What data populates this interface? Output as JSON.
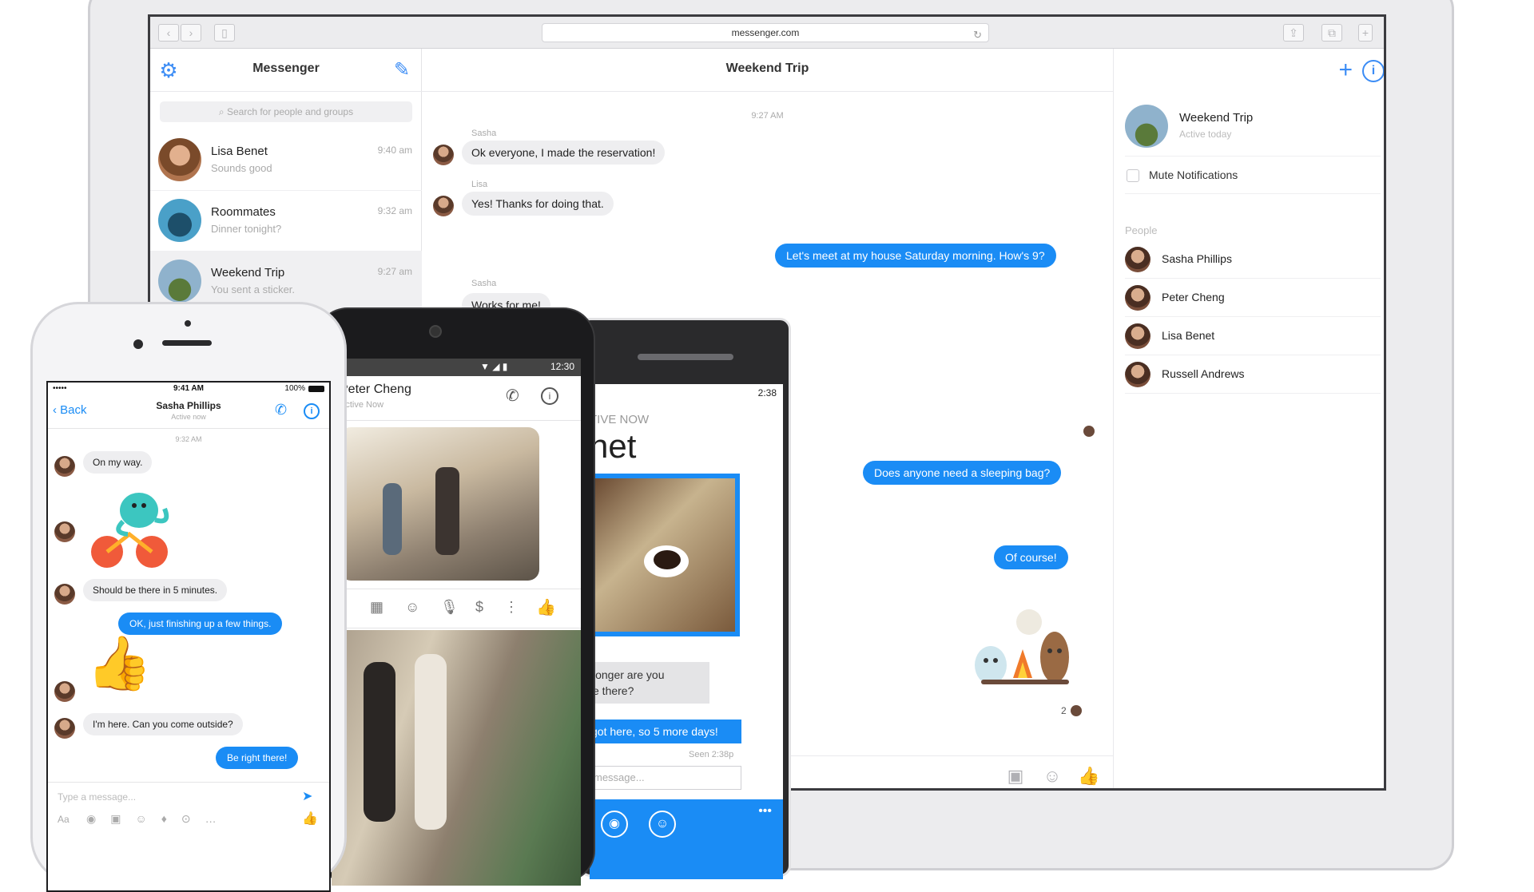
{
  "browser": {
    "url": "messenger.com"
  },
  "messenger_web": {
    "app_title": "Messenger",
    "search_placeholder": "Search for people and groups",
    "conversations": [
      {
        "name": "Lisa Benet",
        "preview": "Sounds good",
        "time": "9:40 am"
      },
      {
        "name": "Roommates",
        "preview": "Dinner tonight?",
        "time": "9:32 am"
      },
      {
        "name": "Weekend Trip",
        "preview": "You sent a sticker.",
        "time": "9:27 am"
      }
    ],
    "chat": {
      "title": "Weekend Trip",
      "timestamp": "9:27 AM",
      "messages": [
        {
          "sender": "Sasha",
          "text": "Ok everyone, I made the reservation!",
          "direction": "in"
        },
        {
          "sender": "Lisa",
          "text": "Yes! Thanks for doing that.",
          "direction": "in"
        },
        {
          "sender": "",
          "text": "Let's meet at my house Saturday morning. How's 9?",
          "direction": "out"
        },
        {
          "sender": "Sasha",
          "text": "Works for me!",
          "direction": "in"
        },
        {
          "sender": "",
          "text": "Does anyone need a sleeping bag?",
          "direction": "out"
        },
        {
          "sender": "",
          "text": "Of course!",
          "direction": "out"
        }
      ],
      "composer_icons": [
        "image-icon",
        "emoji-icon",
        "like-icon"
      ]
    },
    "info": {
      "group_name": "Weekend Trip",
      "group_status": "Active today",
      "mute_label": "Mute Notifications",
      "people_label": "People",
      "people": [
        "Sasha Phillips",
        "Peter Cheng",
        "Lisa Benet",
        "Russell Andrews"
      ]
    },
    "accent": "#1a8cf5"
  },
  "iphone": {
    "status": {
      "carrier": "•••••",
      "time": "9:41 AM",
      "battery": "100%"
    },
    "back_label": "Back",
    "contact_name": "Sasha Phillips",
    "contact_status": "Active now",
    "timestamp": "9:32 AM",
    "messages": [
      {
        "text": "On my way.",
        "direction": "in"
      },
      {
        "text": "Should be there in 5 minutes.",
        "direction": "in"
      },
      {
        "text": "OK, just finishing up a few things.",
        "direction": "out"
      },
      {
        "text": "I'm here. Can you come outside?",
        "direction": "in"
      },
      {
        "text": "Be right there!",
        "direction": "out"
      }
    ],
    "composer_placeholder": "Type a message...",
    "toolbar_label": "Aa"
  },
  "android": {
    "status_time": "12:30",
    "contact_name": "Peter Cheng",
    "contact_status": "Active Now"
  },
  "winphone": {
    "status_time": "2:38",
    "header_partial": "TIVE NOW",
    "name_partial": "net",
    "messages": [
      {
        "text": "longer are you\ne there?",
        "direction": "in"
      },
      {
        "text": "got here, so 5 more days!",
        "direction": "out"
      }
    ],
    "seen_label": "Seen 2:38p",
    "composer_placeholder": "message..."
  }
}
